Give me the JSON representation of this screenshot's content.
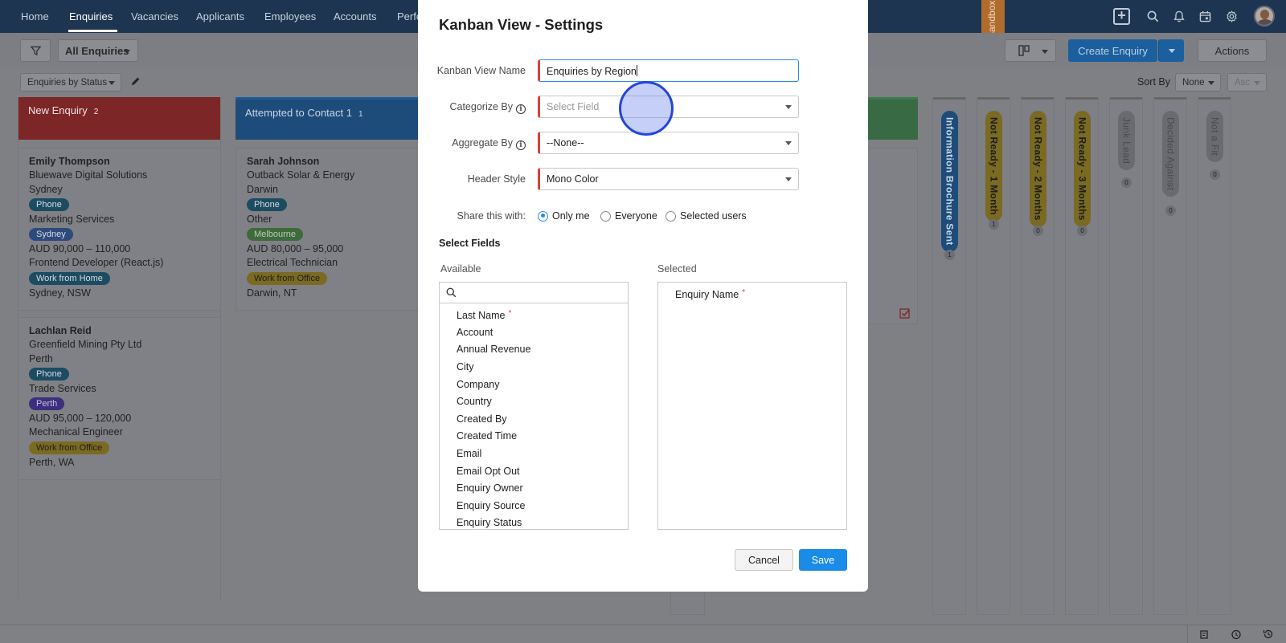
{
  "nav": {
    "tabs": [
      "Home",
      "Enquiries",
      "Vacancies",
      "Applicants",
      "Employees",
      "Accounts",
      "Perfo"
    ],
    "active_tab": "Enquiries",
    "sandbox_label": "Sandbox"
  },
  "toolbar": {
    "view_select": "All Enquiries",
    "create_label": "Create Enquiry",
    "actions_label": "Actions",
    "kanban_select": "Enquiries by Status",
    "sort_by_label": "Sort By",
    "sort_by_value": "None",
    "sort_order": "Asc"
  },
  "kanban": {
    "columns": [
      {
        "title": "New Enquiry",
        "count": "2",
        "cards": [
          {
            "name": "Emily Thompson",
            "company": "Bluewave Digital Solutions",
            "city": "Sydney",
            "source": "Phone",
            "industry": "Marketing Services",
            "region": "Sydney",
            "salary": "AUD 90,000 – 110,000",
            "role": "Frontend Developer (React.js)",
            "mode": "Work from Home",
            "location": "Sydney, NSW"
          },
          {
            "name": "Lachlan Reid",
            "company": "Greenfield Mining Pty Ltd",
            "city": "Perth",
            "source": "Phone",
            "industry": "Trade Services",
            "region": "Perth",
            "salary": "AUD 95,000 – 120,000",
            "role": "Mechanical Engineer",
            "mode": "Work from Office",
            "location": "Perth, WA"
          }
        ]
      },
      {
        "title": "Attempted to Contact 1",
        "count": "1",
        "cards": [
          {
            "name": "Sarah Johnson",
            "company": "Outback Solar & Energy",
            "city": "Darwin",
            "source": "Phone",
            "industry": "Other",
            "region": "Melbourne",
            "salary": "AUD 80,000 – 95,000",
            "role": "Electrical Technician",
            "mode": "Work from Office",
            "location": "Darwin, NT"
          }
        ]
      }
    ],
    "vertical_columns": [
      {
        "title": "Information Brochure Sent",
        "count": "1"
      },
      {
        "title": "Not Ready - 1 Month",
        "count": "1"
      },
      {
        "title": "Not Ready - 2 Months",
        "count": "0"
      },
      {
        "title": "Not Ready - 3 Months",
        "count": "0"
      },
      {
        "title": "Junk Lead",
        "count": "0"
      },
      {
        "title": "Decided Against",
        "count": "0"
      },
      {
        "title": "Not a Fit",
        "count": "0"
      }
    ]
  },
  "modal": {
    "title": "Kanban View - Settings",
    "view_name_label": "Kanban View Name",
    "view_name_value": "Enquiries by Region",
    "categorize_label": "Categorize By",
    "categorize_placeholder": "Select Field",
    "aggregate_label": "Aggregate By",
    "aggregate_value": "--None--",
    "header_style_label": "Header Style",
    "header_style_value": "Mono Color",
    "share_label": "Share this with:",
    "share_options": [
      "Only me",
      "Everyone",
      "Selected users"
    ],
    "share_selected": "Only me",
    "select_fields_label": "Select Fields",
    "available_label": "Available",
    "selected_label": "Selected",
    "available_fields": [
      "Last Name",
      "Account",
      "Annual Revenue",
      "City",
      "Company",
      "Country",
      "Created By",
      "Created Time",
      "Email",
      "Email Opt Out",
      "Enquiry Owner",
      "Enquiry Source",
      "Enquiry Status"
    ],
    "selected_fields": [
      "Enquiry Name"
    ],
    "cancel_label": "Cancel",
    "save_label": "Save",
    "required_mark": "*"
  }
}
